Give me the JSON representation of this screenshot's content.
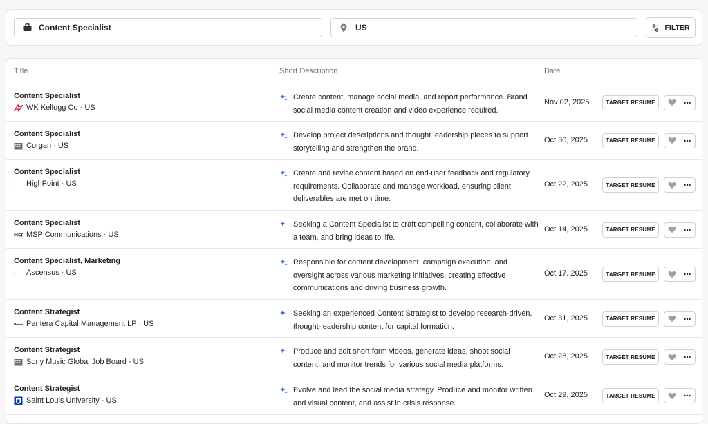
{
  "search": {
    "job_value": "Content Specialist",
    "location_value": "US",
    "filter_label": "FILTER"
  },
  "table": {
    "headers": {
      "title": "Title",
      "description": "Short Description",
      "date": "Date"
    },
    "rows": [
      {
        "title": "Content Specialist",
        "company": "WK Kellogg Co · US",
        "logo": "wk-kellogg-logo",
        "description": "Create content, manage social media, and report performance. Brand social media content creation and video experience required.",
        "date": "Nov 02, 2025",
        "action": "TARGET RESUME"
      },
      {
        "title": "Content Specialist",
        "company": "Corgan · US",
        "logo": "building-logo",
        "description": "Develop project descriptions and thought leadership pieces to support storytelling and strengthen the brand.",
        "date": "Oct 30, 2025",
        "action": "TARGET RESUME"
      },
      {
        "title": "Content Specialist",
        "company": "HighPoint · US",
        "logo": "highpoint-logo",
        "description": "Create and revise content based on end-user feedback and regulatory requirements. Collaborate and manage workload, ensuring client deliverables are met on time.",
        "date": "Oct 22, 2025",
        "action": "TARGET RESUME"
      },
      {
        "title": "Content Specialist",
        "company": "MSP Communications · US",
        "logo": "msp-logo",
        "description": "Seeking a Content Specialist to craft compelling content, collaborate with a team, and bring ideas to life.",
        "date": "Oct 14, 2025",
        "action": "TARGET RESUME"
      },
      {
        "title": "Content Specialist, Marketing",
        "company": "Ascensus · US",
        "logo": "ascensus-logo",
        "description": "Responsible for content development, campaign execution, and oversight across various marketing initiatives, creating effective communications and driving business growth.",
        "date": "Oct 17, 2025",
        "action": "TARGET RESUME"
      },
      {
        "title": "Content Strategist",
        "company": "Pantera Capital Management LP · US",
        "logo": "pantera-logo",
        "description": "Seeking an experienced Content Strategist to develop research-driven, thought-leadership content for capital formation.",
        "date": "Oct 31, 2025",
        "action": "TARGET RESUME"
      },
      {
        "title": "Content Strategist",
        "company": "Sony Music Global Job Board · US",
        "logo": "building-logo",
        "description": "Produce and edit short form videos, generate ideas, shoot social content, and monitor trends for various social media platforms.",
        "date": "Oct 28, 2025",
        "action": "TARGET RESUME"
      },
      {
        "title": "Content Strategist",
        "company": "Saint Louis University · US",
        "logo": "slu-logo",
        "description": "Evolve and lead the social media strategy. Produce and monitor written and visual content, and assist in crisis response.",
        "date": "Oct 29, 2025",
        "action": "TARGET RESUME"
      }
    ]
  },
  "colors": {
    "sparkle": "#3b6fe0",
    "heart": "#9aa0a8",
    "border": "#cfd2d8"
  }
}
